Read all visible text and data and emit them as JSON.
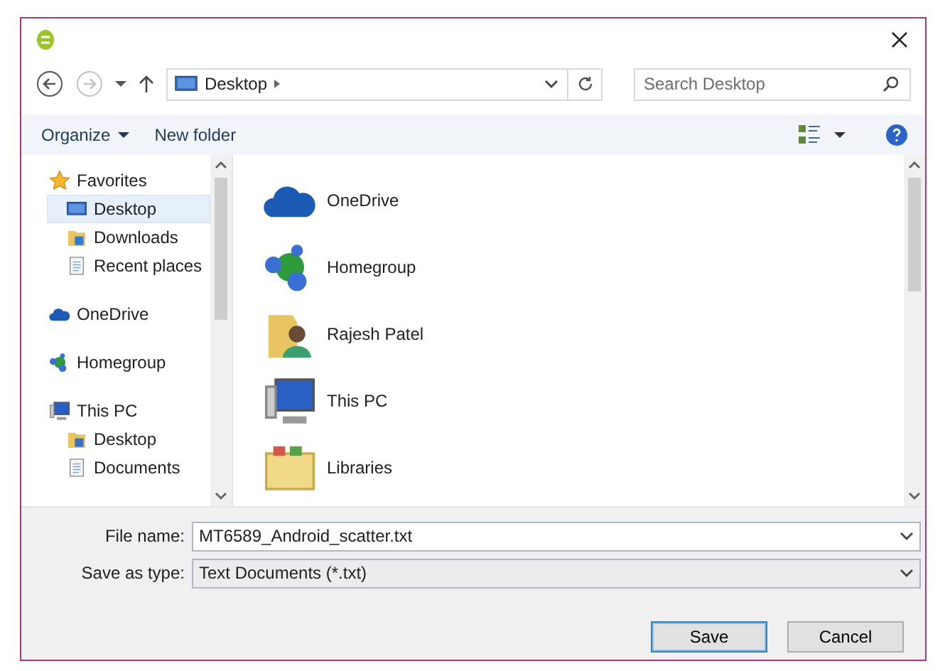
{
  "nav_buttons": [
    {
      "kind": "back",
      "disabled": false
    },
    {
      "kind": "forward",
      "disabled": true
    }
  ],
  "address": {
    "path": [
      "Desktop"
    ]
  },
  "search": {
    "placeholder": "Search Desktop"
  },
  "toolbar": [
    {
      "label": "Organize",
      "dropdown": true
    },
    {
      "label": "New folder",
      "dropdown": false
    }
  ],
  "sidebar": {
    "groups": [
      {
        "label": "Favorites",
        "kind": "star",
        "children": [
          {
            "label": "Desktop",
            "kind": "desktop",
            "selected": true
          },
          {
            "label": "Downloads",
            "kind": "downloads",
            "selected": false
          },
          {
            "label": "Recent places",
            "kind": "recent",
            "selected": false
          }
        ]
      },
      {
        "label": "OneDrive",
        "kind": "cloud"
      },
      {
        "label": "Homegroup",
        "kind": "homegroup"
      },
      {
        "label": "This PC",
        "kind": "pc",
        "children": [
          {
            "label": "Desktop",
            "kind": "folder",
            "selected": false
          },
          {
            "label": "Documents",
            "kind": "documents",
            "selected": false
          }
        ]
      }
    ]
  },
  "items": [
    {
      "label": "OneDrive",
      "kind": "cloud"
    },
    {
      "label": "Homegroup",
      "kind": "homegroup"
    },
    {
      "label": "Rajesh Patel",
      "kind": "user"
    },
    {
      "label": "This PC",
      "kind": "pc"
    },
    {
      "label": "Libraries",
      "kind": "library"
    }
  ],
  "form": {
    "file_name": {
      "label": "File name:",
      "value": "MT6589_Android_scatter.txt"
    },
    "save_type": {
      "label": "Save as type:",
      "value": "Text Documents (*.txt)"
    }
  },
  "buttons": [
    {
      "label": "Save",
      "default": true
    },
    {
      "label": "Cancel",
      "default": false
    }
  ]
}
